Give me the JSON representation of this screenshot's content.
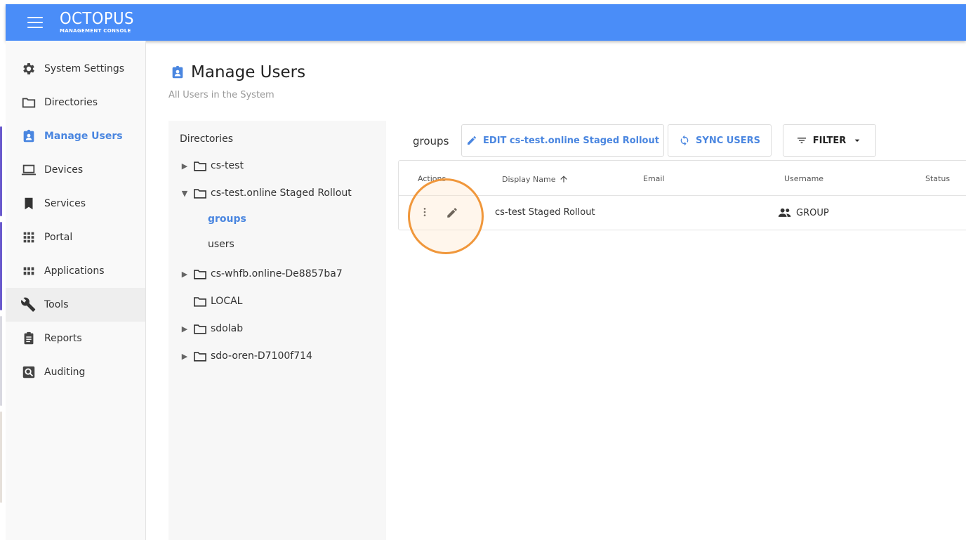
{
  "app": {
    "brand": "OCTOPUS",
    "brand_sub": "MANAGEMENT CONSOLE"
  },
  "sidebar": {
    "items": [
      {
        "label": "System Settings",
        "icon": "gear-icon"
      },
      {
        "label": "Directories",
        "icon": "folder-icon"
      },
      {
        "label": "Manage Users",
        "icon": "user-badge-icon"
      },
      {
        "label": "Devices",
        "icon": "laptop-icon"
      },
      {
        "label": "Services",
        "icon": "bookmark-icon"
      },
      {
        "label": "Portal",
        "icon": "grid-icon"
      },
      {
        "label": "Applications",
        "icon": "apps-icon"
      },
      {
        "label": "Tools",
        "icon": "wrench-icon"
      },
      {
        "label": "Reports",
        "icon": "clipboard-icon"
      },
      {
        "label": "Auditing",
        "icon": "search-box-icon"
      }
    ]
  },
  "page": {
    "title": "Manage Users",
    "subtitle": "All Users in the System"
  },
  "directories": {
    "title": "Directories",
    "tree": [
      {
        "label": "cs-test",
        "expanded": false
      },
      {
        "label": "cs-test.online Staged Rollout",
        "expanded": true,
        "children": [
          "groups",
          "users"
        ]
      },
      {
        "label": "cs-whfb.online-De8857ba7",
        "expanded": false
      },
      {
        "label": "LOCAL",
        "expanded": false
      },
      {
        "label": "sdolab",
        "expanded": false
      },
      {
        "label": "sdo-oren-D7100f714",
        "expanded": false
      }
    ]
  },
  "toolbar": {
    "current": "groups",
    "edit_label": "EDIT cs-test.online Staged Rollout",
    "sync_label": "SYNC USERS",
    "filter_label": "FILTER"
  },
  "table": {
    "columns": [
      "Actions",
      "Display Name",
      "Email",
      "Username",
      "Status"
    ],
    "rows": [
      {
        "display_name": "cs-test Staged Rollout",
        "email": "",
        "username": "GROUP",
        "status": ""
      }
    ]
  },
  "colors": {
    "header": "#4a8df8",
    "accent": "#4a86e0",
    "highlight": "#f0973b"
  }
}
